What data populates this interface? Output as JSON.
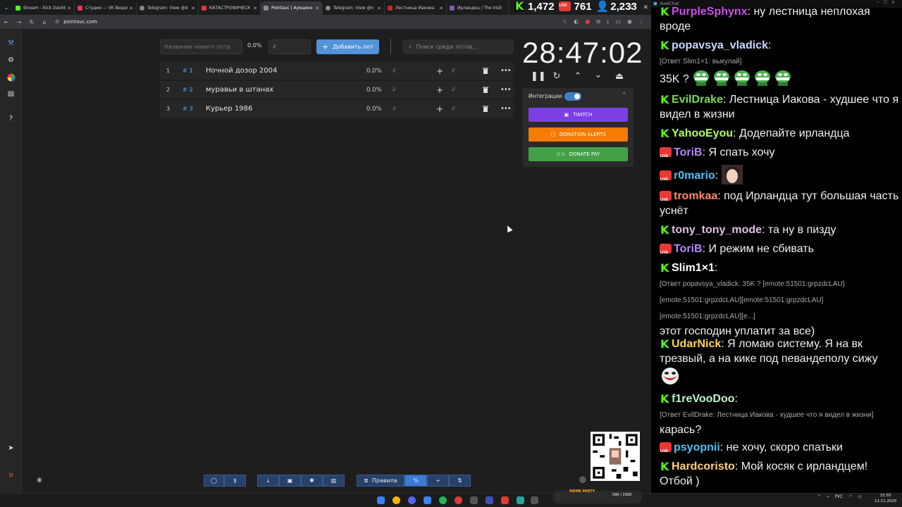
{
  "browser": {
    "tabs": [
      {
        "title": "Stream - Kick Dashb",
        "favicon_color": "#53fc18",
        "active": false
      },
      {
        "title": "Студия — VK Видео",
        "favicon_color": "#e53950",
        "active": false
      },
      {
        "title": "Telegram: View @d",
        "favicon_color": "#8a8a8a",
        "active": false
      },
      {
        "title": "КАТАСТРОФИЧЕСК",
        "favicon_color": "#e53935",
        "active": false
      },
      {
        "title": "Pointauc | Аукцион",
        "favicon_color": "#8a8a8a",
        "active": true
      },
      {
        "title": "Telegram: View @n",
        "favicon_color": "#8a8a8a",
        "active": false
      },
      {
        "title": "Лестница Иакова",
        "favicon_color": "#c62828",
        "active": false
      },
      {
        "title": "Ирландец / The Irish",
        "favicon_color": "#7e57c2",
        "active": false
      }
    ],
    "url": "pointauc.com",
    "stream_stats": {
      "kick_viewers": "1,472",
      "vk_viewers": "761",
      "total_viewers": "2,233"
    }
  },
  "auction": {
    "new_lot_placeholder": "Название нового лота",
    "percent_default": "0.0%",
    "currency_placeholder": "₽",
    "add_button": "Добавить лот",
    "search_placeholder": "Поиск среди лотов...",
    "lots": [
      {
        "num": "1",
        "id": "# 1",
        "name": "Ночной дозор 2004",
        "pct": "0.0%",
        "currency": "₽"
      },
      {
        "num": "2",
        "id": "# 2",
        "name": "муравьи в штанах",
        "pct": "0.0%",
        "currency": "₽"
      },
      {
        "num": "3",
        "id": "# 3",
        "name": "Курьер 1986",
        "pct": "0.0%",
        "currency": "₽"
      }
    ],
    "timer": "28:47:02",
    "integrations": {
      "label": "Интеграции",
      "enabled": true,
      "buttons": [
        {
          "label": "TWITCH",
          "color": "#7b3fe4"
        },
        {
          "label": "DONATION ALERTS",
          "color": "#f57c00"
        },
        {
          "label": "DONATE PAY",
          "color": "#43a047"
        }
      ]
    },
    "bottom_toolbar": {
      "rules_label": "Правила",
      "percent_label": "%"
    }
  },
  "chat": {
    "window_title": "AxelChat",
    "messages": [
      {
        "platform": "kick",
        "user": "PurpleSphynx",
        "user_color": "#d04ff0",
        "text": "ну лестница неплохая вроде"
      },
      {
        "platform": "kick",
        "user": "popavsya_vladick",
        "user_color": "#c9d7ff",
        "reply": "[Ответ Slim1×1: выкулай]",
        "text": "35K ?"
      },
      {
        "platform": "kick",
        "user": "EvilDrake",
        "user_color": "#7ed957",
        "text": "Лестница Иакова - худшее что я видел в жизни"
      },
      {
        "platform": "kick",
        "user": "YahooEyou",
        "user_color": "#b2ff59",
        "text": "Додепайте ирландца"
      },
      {
        "platform": "vk",
        "user": "ToriB",
        "user_color": "#b388ff",
        "text": "Я спать хочу"
      },
      {
        "platform": "vk",
        "user": "r0mario",
        "user_color": "#4fc3f7",
        "text": ""
      },
      {
        "platform": "vk",
        "user": "tromkaa",
        "user_color": "#ff8a65",
        "text": "под Ирландца тут большая часть уснёт"
      },
      {
        "platform": "kick",
        "user": "tony_tony_mode",
        "user_color": "#e1bee7",
        "text": "та ну в пизду"
      },
      {
        "platform": "vk",
        "user": "ToriB",
        "user_color": "#b388ff",
        "text": "И режим не сбивать"
      },
      {
        "platform": "kick",
        "user": "Slim1×1",
        "user_color": "#ffffff",
        "reply": "[Ответ popavsya_vladick: 35K ? [emote:51501:grpzdcLAU][emote:51501:grpzdcLAU][emote:51501:grpzdcLAU][emote:51501:grpzdcLAU][e...]",
        "text": "этот господин уплатит за все)"
      },
      {
        "platform": "kick",
        "user": "UdarNick",
        "user_color": "#ffd54f",
        "text": "Я ломаю систему. Я на вк трезвый, а на кике под певандеполу сижу"
      },
      {
        "platform": "kick",
        "user": "f1reVooDoo",
        "user_color": "#b9f6ca",
        "reply": "[Ответ EvilDrake: Лестница Иакова - худшее что я видел в жизни]",
        "text": "карась?"
      },
      {
        "platform": "vk",
        "user": "psyopnii",
        "user_color": "#4fc3f7",
        "text": "не хочу, скоро спатьки"
      },
      {
        "platform": "kick",
        "user": "Hardcoristo",
        "user_color": "#ffcc80",
        "text": "Мой косяк с ирландцем! Отбой )"
      }
    ]
  },
  "taskbar": {
    "widget_title": "MEME PARTY",
    "widget_value": "590 / 1500",
    "lang": "РУС",
    "time": "21:55",
    "date": "11.11.2025"
  }
}
